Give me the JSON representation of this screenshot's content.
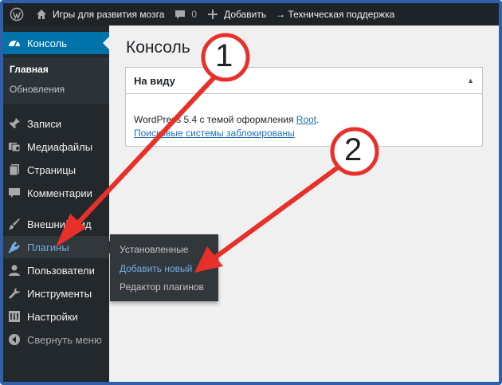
{
  "adminbar": {
    "site_title": "Игры для развития мозга",
    "comments_count": "0",
    "add_new": "Добавить",
    "support_link": "→ Техническая поддержка"
  },
  "sidebar": {
    "dashboard": "Консоль",
    "dashboard_sub": {
      "home": "Главная",
      "updates": "Обновления"
    },
    "items": [
      {
        "label": "Записи",
        "icon": "pin-icon"
      },
      {
        "label": "Медиафайлы",
        "icon": "media-icon"
      },
      {
        "label": "Страницы",
        "icon": "pages-icon"
      },
      {
        "label": "Комментарии",
        "icon": "comments-icon"
      },
      {
        "label": "Внешний вид",
        "icon": "appearance-icon"
      },
      {
        "label": "Плагины",
        "icon": "plugins-icon"
      },
      {
        "label": "Пользователи",
        "icon": "users-icon"
      },
      {
        "label": "Инструменты",
        "icon": "tools-icon"
      },
      {
        "label": "Настройки",
        "icon": "settings-icon"
      }
    ],
    "collapse": "Свернуть меню"
  },
  "flyout": {
    "installed": "Установленные",
    "add_new": "Добавить новый",
    "editor": "Редактор плагинов"
  },
  "main": {
    "title": "Консоль",
    "widget": {
      "title": "На виду",
      "text_prefix": "WordPress 5.4 с темой оформления ",
      "theme_link": "Root",
      "text_suffix": ".",
      "search_engines": "Поисковые системы заблокированы"
    }
  },
  "annotations": {
    "first": "1",
    "second": "2"
  },
  "colors": {
    "accent": "#0073aa",
    "sidebar_bg": "#23282d",
    "adminbar_bg": "#1d2327",
    "annotation_red": "#e8302a",
    "frame": "#2f5fa8"
  }
}
